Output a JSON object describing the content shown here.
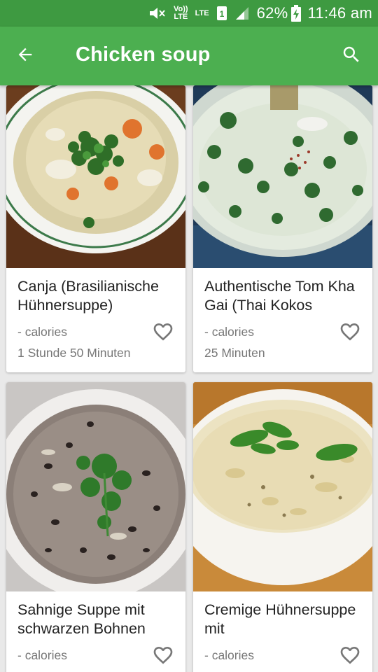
{
  "status_bar": {
    "volte": "Vo))\nLTE",
    "lte": "LTE",
    "battery": "62%",
    "time": "11:46 am"
  },
  "app_bar": {
    "title": "Chicken soup",
    "back_icon": "arrow-back-icon",
    "search_icon": "search-icon"
  },
  "colors": {
    "status_bar": "#3e9a41",
    "app_bar": "#4caf50",
    "background": "#e9e9e9"
  },
  "recipes": [
    {
      "name": "Canja (Brasilianische Hühnersuppe)",
      "calories": "- calories",
      "time": "1 Stunde 50 Minuten",
      "favorite_icon": "heart-outline-icon"
    },
    {
      "name": "Authentische Tom Kha Gai (Thai Kokos",
      "calories": "- calories",
      "time": "25 Minuten",
      "favorite_icon": "heart-outline-icon"
    },
    {
      "name": "Sahnige Suppe mit schwarzen Bohnen",
      "calories": "- calories",
      "time": "",
      "favorite_icon": "heart-outline-icon"
    },
    {
      "name": "Cremige Hühnersuppe mit",
      "calories": "- calories",
      "time": "",
      "favorite_icon": "heart-outline-icon"
    }
  ]
}
